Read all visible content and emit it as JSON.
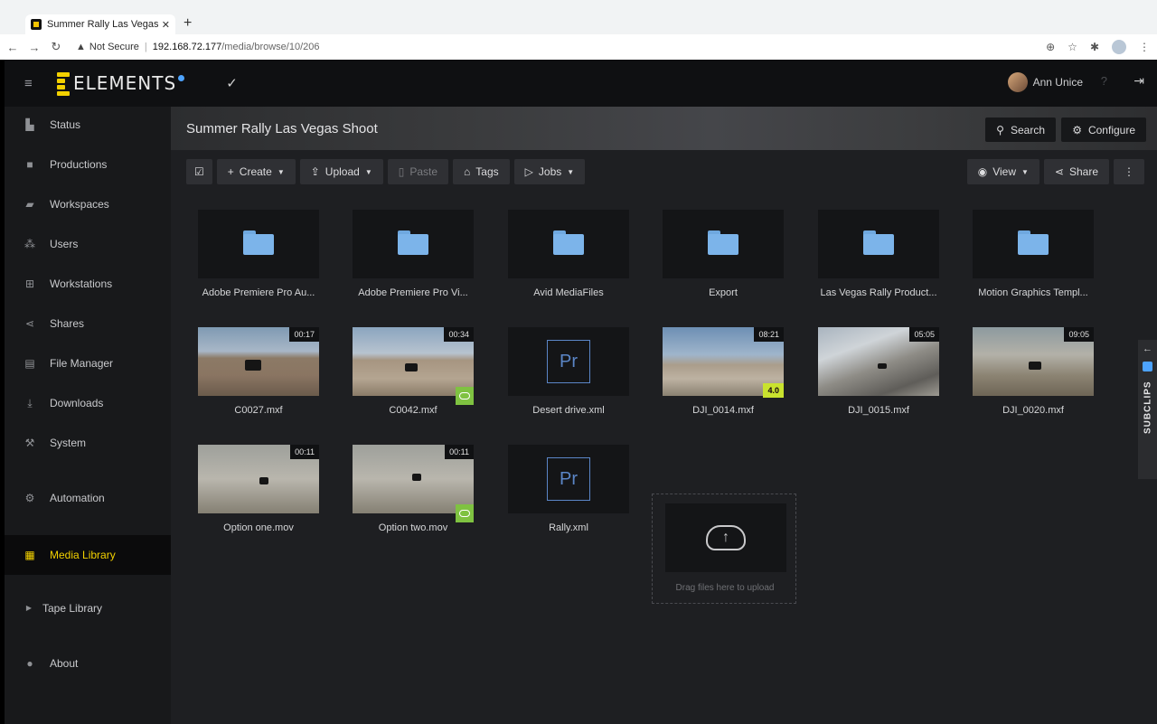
{
  "browser": {
    "tab_title": "Summer Rally Las Vegas Shoo",
    "tab_close": "✕",
    "new_tab": "+",
    "not_secure": "Not Secure",
    "url_host": "192.168.72.177",
    "url_path": "/media/browse/10/206"
  },
  "app": {
    "logo_text": "ELEMENTS",
    "user_name": "Ann Unice",
    "help": "?",
    "accent_color": "#f3d100"
  },
  "sidebar": {
    "items": [
      {
        "label": "Status",
        "icon": "chart-icon"
      },
      {
        "label": "Productions",
        "icon": "briefcase-icon"
      },
      {
        "label": "Workspaces",
        "icon": "folder-open-icon"
      },
      {
        "label": "Users",
        "icon": "users-icon"
      },
      {
        "label": "Workstations",
        "icon": "network-icon"
      },
      {
        "label": "Shares",
        "icon": "share-icon"
      },
      {
        "label": "File Manager",
        "icon": "folders-icon"
      },
      {
        "label": "Downloads",
        "icon": "download-icon"
      },
      {
        "label": "System",
        "icon": "wrench-icon"
      },
      {
        "label": "Automation",
        "icon": "cogs-icon"
      },
      {
        "label": "Media Library",
        "icon": "film-icon",
        "active": true
      },
      {
        "label": "Tape Library",
        "icon": "caret-right-icon"
      },
      {
        "label": "About",
        "icon": "info-icon"
      }
    ]
  },
  "main": {
    "title": "Summer Rally Las Vegas Shoot",
    "search_label": "Search",
    "configure_label": "Configure",
    "toolbar": {
      "create": "Create",
      "upload": "Upload",
      "paste": "Paste",
      "tags": "Tags",
      "jobs": "Jobs",
      "view": "View",
      "share": "Share"
    },
    "folders": [
      "Adobe Premiere Pro Au...",
      "Adobe Premiere Pro Vi...",
      "Avid MediaFiles",
      "Export",
      "Las Vegas Rally Product...",
      "Motion Graphics Templ..."
    ],
    "files_row2": [
      {
        "name": "C0027.mxf",
        "duration": "00:17"
      },
      {
        "name": "C0042.mxf",
        "duration": "00:34",
        "cloud": true
      },
      {
        "name": "Desert drive.xml",
        "pr": "Pr"
      },
      {
        "name": "DJI_0014.mxf",
        "duration": "08:21",
        "version": "4.0"
      },
      {
        "name": "DJI_0015.mxf",
        "duration": "05:05"
      },
      {
        "name": "DJI_0020.mxf",
        "duration": "09:05"
      }
    ],
    "files_row3": [
      {
        "name": "Option one.mov",
        "duration": "00:11"
      },
      {
        "name": "Option two.mov",
        "duration": "00:11",
        "cloud": true
      },
      {
        "name": "Rally.xml",
        "pr": "Pr"
      }
    ],
    "dropzone_text": "Drag files here to upload",
    "subclips_label": "SUBCLIPS"
  }
}
